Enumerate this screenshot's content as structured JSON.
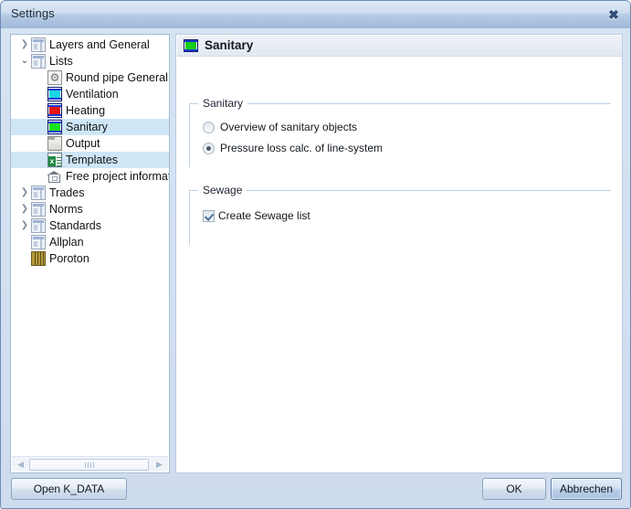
{
  "window": {
    "title": "Settings",
    "close_label": "✖"
  },
  "tree": {
    "items": [
      {
        "label": "Layers and General",
        "indent": 0,
        "twisty": "collapsed",
        "icon": "window-icon",
        "selected": false
      },
      {
        "label": "Lists",
        "indent": 0,
        "twisty": "expanded",
        "icon": "window-icon",
        "selected": false
      },
      {
        "label": "Round pipe General",
        "indent": 1,
        "twisty": "none",
        "icon": "gear-icon",
        "selected": false
      },
      {
        "label": "Ventilation",
        "indent": 1,
        "twisty": "none",
        "icon": "duct-cyan-icon",
        "selected": false
      },
      {
        "label": "Heating",
        "indent": 1,
        "twisty": "none",
        "icon": "duct-red-icon",
        "selected": false
      },
      {
        "label": "Sanitary",
        "indent": 1,
        "twisty": "none",
        "icon": "duct-green-icon",
        "selected": true
      },
      {
        "label": "Output",
        "indent": 1,
        "twisty": "none",
        "icon": "folder-icon",
        "selected": false
      },
      {
        "label": "Templates",
        "indent": 1,
        "twisty": "none",
        "icon": "excel-icon",
        "selected": true
      },
      {
        "label": "Free project informat",
        "indent": 1,
        "twisty": "none",
        "icon": "home-icon",
        "selected": false
      },
      {
        "label": "Trades",
        "indent": 0,
        "twisty": "collapsed",
        "icon": "window-icon",
        "selected": false
      },
      {
        "label": "Norms",
        "indent": 0,
        "twisty": "collapsed",
        "icon": "window-icon",
        "selected": false
      },
      {
        "label": "Standards",
        "indent": 0,
        "twisty": "collapsed",
        "icon": "window-icon",
        "selected": false
      },
      {
        "label": "Allplan",
        "indent": 0,
        "twisty": "none",
        "icon": "window-icon",
        "selected": false
      },
      {
        "label": "Poroton",
        "indent": 0,
        "twisty": "none",
        "icon": "brick-icon",
        "selected": false
      }
    ],
    "twisty_collapsed_glyph": "❯",
    "twisty_expanded_glyph": "⌄",
    "scrollbar": {
      "left_arrow": "◀",
      "right_arrow": "▶"
    }
  },
  "content": {
    "header_title": "Sanitary",
    "groups": [
      {
        "legend": "Sanitary",
        "options": [
          {
            "label": "Overview of sanitary objects",
            "selected": false
          },
          {
            "label": "Pressure loss calc. of line-system",
            "selected": true
          }
        ]
      },
      {
        "legend": "Sewage",
        "checkboxes": [
          {
            "label": "Create Sewage list",
            "checked": true
          }
        ]
      }
    ]
  },
  "footer": {
    "open_data_label": "Open K_DATA",
    "ok_label": "OK",
    "cancel_label": "Abbrechen"
  },
  "colors": {
    "accent": "#cfe6f7",
    "title_bar": "#9fbada",
    "sanitary_green": "#19e219",
    "heating_red": "#e21414",
    "ventilation_cyan": "#19d7e2"
  }
}
